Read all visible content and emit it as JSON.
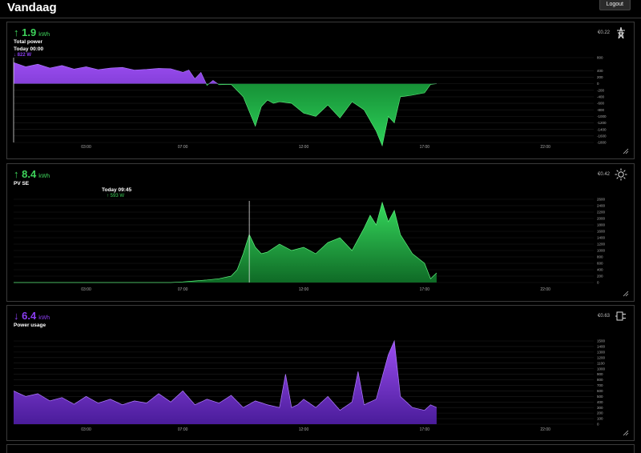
{
  "header": {
    "title": "Vandaag",
    "logout_label": "Logout"
  },
  "panels": [
    {
      "id": "total",
      "value": "1.9",
      "unit": "kWh",
      "arrow": "↑",
      "value_color": "#3dd35a",
      "label": "Total power",
      "cursor_time": "Today 00:00",
      "cursor_value": "↓ 822 W",
      "cost": "€0.22",
      "icon": "power-pylon-icon"
    },
    {
      "id": "pv",
      "value": "8.4",
      "unit": "kWh",
      "arrow": "↑",
      "value_color": "#3dd35a",
      "label": "PV SE",
      "cursor_time": "Today 09:45",
      "cursor_value": "↑ 593 W",
      "cost": "€0.42",
      "icon": "sun-icon"
    },
    {
      "id": "usage",
      "value": "6.4",
      "unit": "kWh",
      "arrow": "↓",
      "value_color": "#8a3df0",
      "label": "Power usage",
      "cost": "€0.63",
      "icon": "plug-icon"
    }
  ],
  "chart_data": [
    {
      "type": "area",
      "title": "Total power",
      "x_ticks": [
        "03:00",
        "07:00",
        "12:00",
        "17:00",
        "22:00"
      ],
      "y_ticks": [
        "800",
        "400",
        "200",
        "0",
        "-200",
        "-400",
        "-600",
        "-800",
        "-1000",
        "-1200",
        "-1400",
        "-1600",
        "-1800"
      ],
      "x_hours": [
        0,
        0.5,
        1,
        1.5,
        2,
        2.5,
        3,
        3.5,
        4,
        4.5,
        5,
        5.5,
        6,
        6.5,
        7,
        7.25,
        7.5,
        7.75,
        8,
        8.25,
        8.5,
        9,
        9.5,
        10,
        10.25,
        10.5,
        10.75,
        11,
        11.5,
        12,
        12.5,
        13,
        13.5,
        14,
        14.5,
        15,
        15.25,
        15.5,
        15.75,
        16,
        16.5,
        17,
        17.25,
        17.5
      ],
      "values": [
        650,
        520,
        600,
        480,
        560,
        450,
        520,
        430,
        480,
        500,
        420,
        440,
        470,
        460,
        350,
        420,
        150,
        350,
        -50,
        100,
        -30,
        -20,
        -400,
        -1300,
        -700,
        -500,
        -600,
        -550,
        -600,
        -900,
        -1000,
        -650,
        -1050,
        -550,
        -800,
        -1450,
        -1900,
        -1000,
        -1200,
        -400,
        -350,
        -280,
        -20,
        0
      ],
      "positive_color": "#7b2fd6",
      "negative_color": "#22b548"
    },
    {
      "type": "area",
      "title": "PV SE",
      "x_ticks": [
        "03:00",
        "07:00",
        "12:00",
        "17:00",
        "22:00"
      ],
      "y_ticks": [
        "2600",
        "2400",
        "2200",
        "2000",
        "1800",
        "1600",
        "1400",
        "1200",
        "1000",
        "800",
        "600",
        "400",
        "200",
        "0"
      ],
      "x_hours": [
        0,
        3,
        6,
        6.5,
        7,
        7.5,
        8,
        8.5,
        9,
        9.25,
        9.5,
        9.75,
        10,
        10.25,
        10.5,
        11,
        11.5,
        12,
        12.5,
        13,
        13.5,
        14,
        14.5,
        14.75,
        15,
        15.25,
        15.5,
        15.75,
        16,
        16.5,
        17,
        17.25,
        17.5
      ],
      "values": [
        0,
        0,
        0,
        0,
        20,
        50,
        80,
        120,
        200,
        400,
        900,
        1500,
        1100,
        900,
        950,
        1200,
        1000,
        1100,
        900,
        1250,
        1400,
        1000,
        1700,
        2100,
        1800,
        2500,
        1900,
        2250,
        1500,
        900,
        600,
        120,
        300
      ],
      "color": "#22b548"
    },
    {
      "type": "area",
      "title": "Power usage",
      "x_ticks": [
        "03:00",
        "07:00",
        "12:00",
        "17:00",
        "22:00"
      ],
      "y_ticks": [
        "1500",
        "1400",
        "1300",
        "1200",
        "1100",
        "1000",
        "900",
        "800",
        "700",
        "600",
        "500",
        "400",
        "300",
        "200",
        "100",
        "0"
      ],
      "x_hours": [
        0,
        0.5,
        1,
        1.5,
        2,
        2.5,
        3,
        3.5,
        4,
        4.5,
        5,
        5.5,
        6,
        6.5,
        7,
        7.5,
        8,
        8.5,
        9,
        9.5,
        10,
        10.5,
        11,
        11.25,
        11.5,
        11.75,
        12,
        12.5,
        13,
        13.5,
        14,
        14.25,
        14.5,
        15,
        15.5,
        15.75,
        16,
        16.25,
        16.5,
        17,
        17.25,
        17.5
      ],
      "values": [
        600,
        500,
        550,
        420,
        480,
        360,
        500,
        380,
        450,
        350,
        420,
        380,
        550,
        400,
        600,
        350,
        450,
        380,
        520,
        300,
        420,
        350,
        300,
        900,
        300,
        350,
        450,
        300,
        500,
        250,
        400,
        950,
        350,
        450,
        1250,
        1500,
        500,
        400,
        300,
        250,
        350,
        300
      ],
      "color": "#7b2fd6"
    }
  ]
}
